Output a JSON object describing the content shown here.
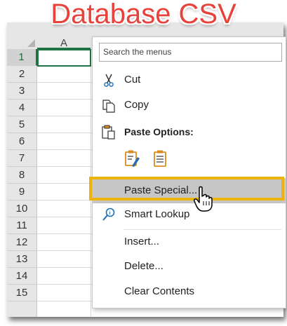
{
  "title": "Database CSV",
  "spreadsheet": {
    "column_header": "A",
    "row_numbers": [
      "1",
      "2",
      "3",
      "4",
      "5",
      "6",
      "7",
      "8",
      "9",
      "10",
      "11",
      "12",
      "13",
      "14",
      "15"
    ]
  },
  "context_menu": {
    "search_placeholder": "Search the menus",
    "items": {
      "cut": "Cut",
      "copy": "Copy",
      "paste_options": "Paste Options:",
      "paste_special": "Paste Special...",
      "smart_lookup": "Smart Lookup",
      "insert": "Insert...",
      "delete": "Delete...",
      "clear_contents": "Clear Contents"
    }
  },
  "colors": {
    "title": "#e8423d",
    "highlight_frame": "#ecb30c",
    "excel_green": "#217346"
  },
  "icons": [
    "scissors-icon",
    "copy-icon",
    "paste-icon",
    "paste-formatting-icon",
    "paste-values-icon",
    "smart-lookup-icon",
    "hand-cursor-icon"
  ]
}
